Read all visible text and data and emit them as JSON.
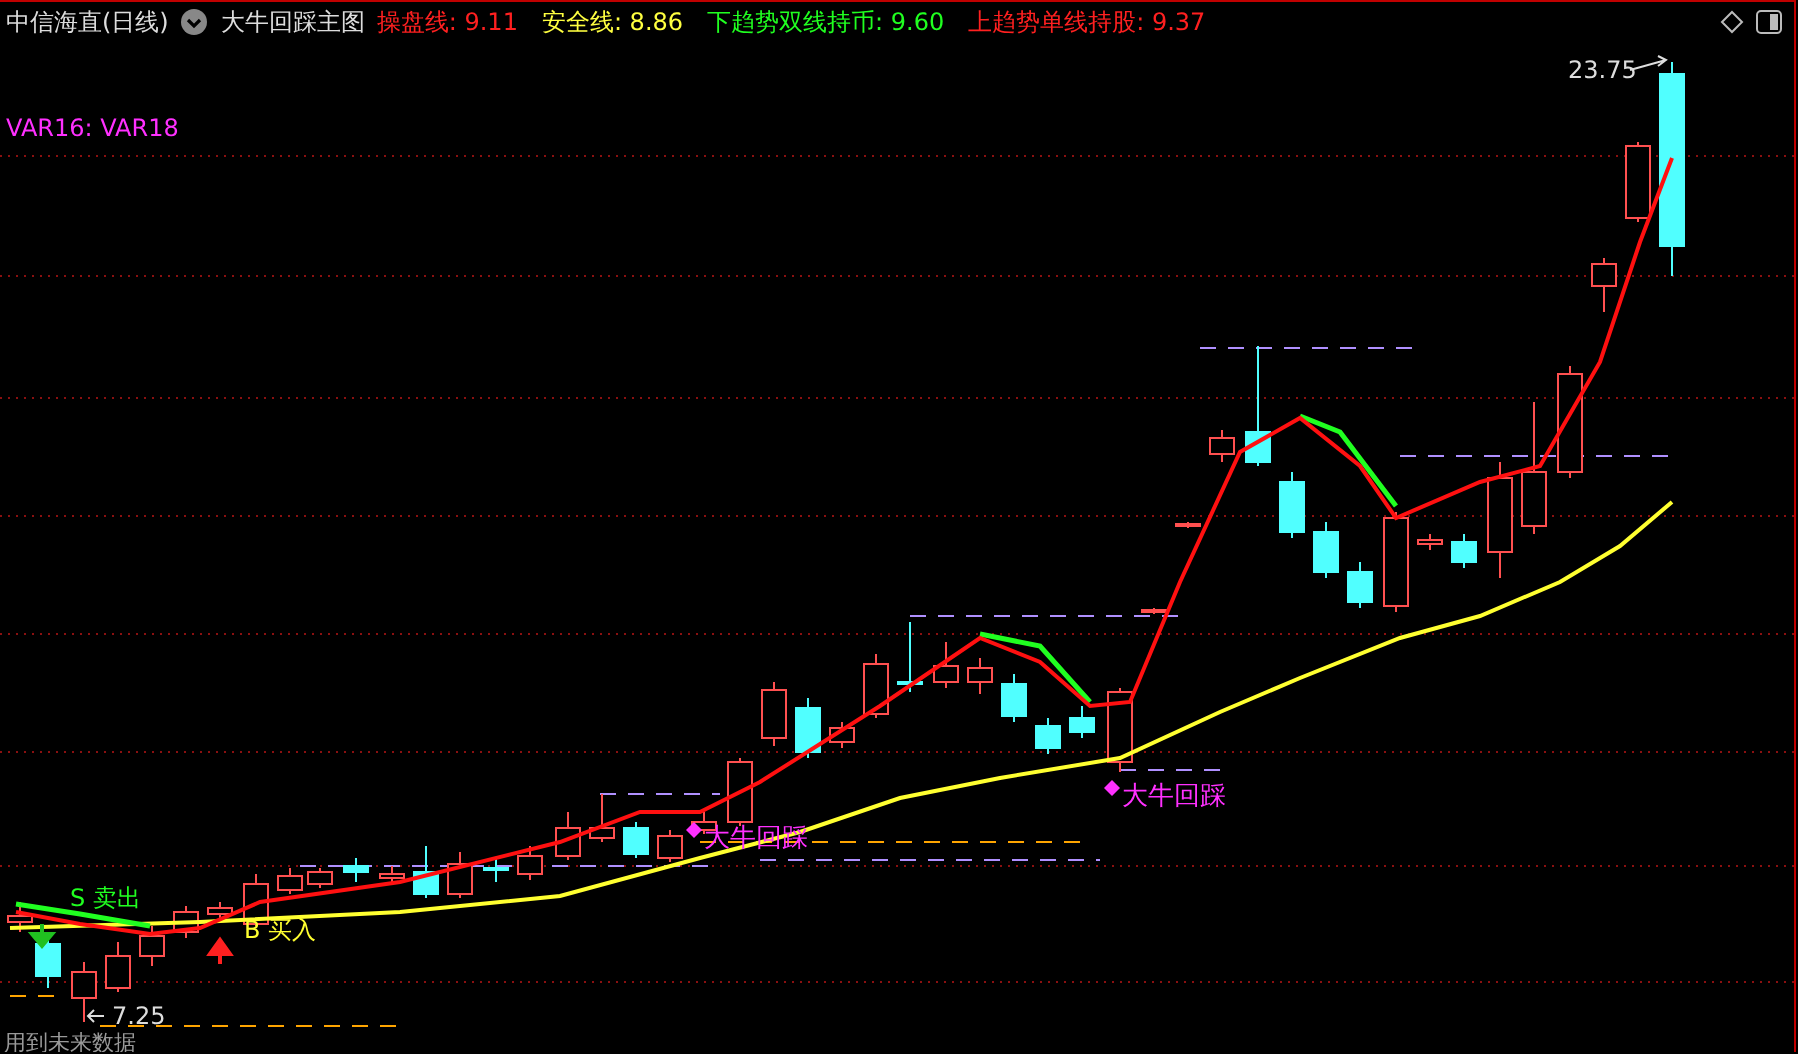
{
  "header": {
    "title": "中信海直(日线)",
    "indicator_name": "大牛回踩主图",
    "values": [
      {
        "text": "操盘线: 9.11",
        "color": "#ff2020"
      },
      {
        "text": "安全线: 8.86",
        "color": "#ffff40"
      },
      {
        "text": "下趋势双线持币: 9.60",
        "color": "#20ff20"
      },
      {
        "text": "上趋势单线持股: 9.37",
        "color": "#ff2020"
      }
    ]
  },
  "chart": {
    "legend": "VAR16: VAR18",
    "signals": [
      {
        "kind": "sell",
        "text": "S 卖出"
      },
      {
        "kind": "buy",
        "text": "B 买入"
      }
    ],
    "pattern_labels": [
      "大牛回踩",
      "大牛回踩"
    ],
    "high_label": "23.75",
    "low_label": "7.25",
    "footer_note": "用到未来数据"
  }
}
